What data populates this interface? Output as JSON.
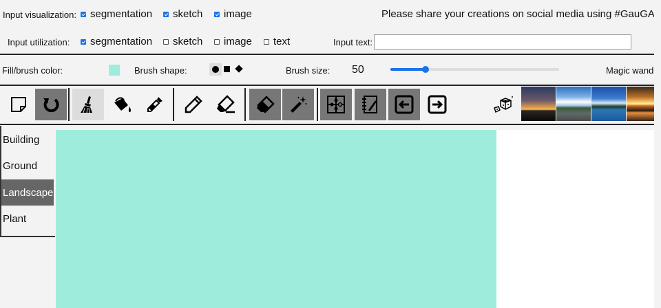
{
  "row1": {
    "label": "Input visualization:",
    "options": [
      {
        "label": "segmentation",
        "checked": true
      },
      {
        "label": "sketch",
        "checked": true
      },
      {
        "label": "image",
        "checked": true
      }
    ],
    "share_text": "Please share your creations on social media using #GauGAN"
  },
  "row2": {
    "label": "Input utilization:",
    "options": [
      {
        "label": "segmentation",
        "checked": true
      },
      {
        "label": "sketch",
        "checked": false
      },
      {
        "label": "image",
        "checked": false
      },
      {
        "label": "text",
        "checked": false
      }
    ],
    "input_text_label": "Input text:",
    "input_text_value": ""
  },
  "row3": {
    "fill_label": "Fill/brush color:",
    "fill_color": "#9eeddc",
    "brush_shape_label": "Brush shape:",
    "brush_size_label": "Brush size:",
    "brush_size_value": "50",
    "brush_size_fraction": 0.16,
    "magic_wand_label": "Magic wand"
  },
  "toolbar": {
    "tools": [
      {
        "icon": "new-canvas-icon"
      },
      {
        "icon": "undo-icon"
      },
      {
        "icon": "brush-icon"
      },
      {
        "icon": "paint-bucket-icon"
      },
      {
        "icon": "eyedropper-icon"
      },
      {
        "icon": "pencil-icon"
      },
      {
        "icon": "pencil-eraser-icon"
      },
      {
        "icon": "eraser-icon"
      },
      {
        "icon": "magic-wand-icon"
      },
      {
        "icon": "puzzle-icon"
      },
      {
        "icon": "notebook-icon"
      },
      {
        "icon": "arrow-left-icon"
      },
      {
        "icon": "arrow-right-icon"
      },
      {
        "icon": "dice-icon"
      }
    ]
  },
  "sidebar": {
    "items": [
      {
        "label": "Building",
        "active": false
      },
      {
        "label": "Ground",
        "active": false
      },
      {
        "label": "Landscape",
        "active": true
      },
      {
        "label": "Plant",
        "active": false
      }
    ]
  },
  "colors": {
    "canvas": "#9eeddc",
    "slider": "#1a73e8",
    "dark_tool": "#777777"
  }
}
